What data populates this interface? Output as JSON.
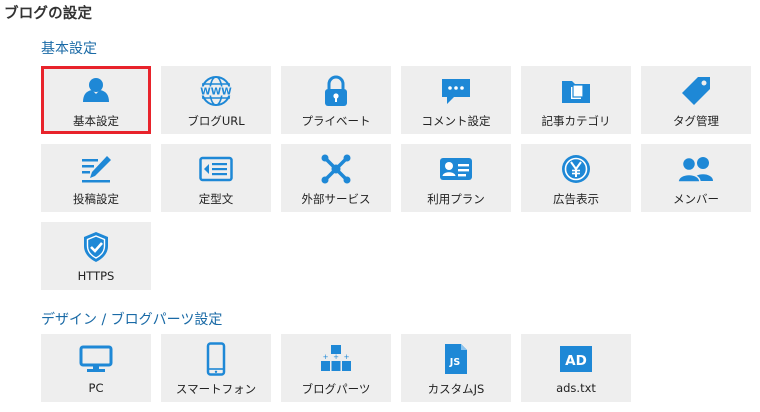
{
  "page": {
    "title": "ブログの設定"
  },
  "colors": {
    "icon": "#1e88d6",
    "selected_border": "#e8232b",
    "tile_bg": "#eeeeee",
    "section_title": "#1a6aa6"
  },
  "sections": [
    {
      "title": "基本設定",
      "items": [
        {
          "label": "基本設定",
          "icon": "user-icon",
          "selected": true
        },
        {
          "label": "ブログURL",
          "icon": "www-globe-icon"
        },
        {
          "label": "プライベート",
          "icon": "lock-icon"
        },
        {
          "label": "コメント設定",
          "icon": "comment-icon"
        },
        {
          "label": "記事カテゴリ",
          "icon": "folder-icon"
        },
        {
          "label": "タグ管理",
          "icon": "tag-icon"
        },
        {
          "label": "投稿設定",
          "icon": "pencil-icon"
        },
        {
          "label": "定型文",
          "icon": "template-icon"
        },
        {
          "label": "外部サービス",
          "icon": "external-services-icon"
        },
        {
          "label": "利用プラン",
          "icon": "plan-card-icon"
        },
        {
          "label": "広告表示",
          "icon": "yen-coin-icon"
        },
        {
          "label": "メンバー",
          "icon": "members-icon"
        },
        {
          "label": "HTTPS",
          "icon": "shield-check-icon"
        }
      ]
    },
    {
      "title": "デザイン / ブログパーツ設定",
      "items": [
        {
          "label": "PC",
          "icon": "monitor-icon"
        },
        {
          "label": "スマートフォン",
          "icon": "smartphone-icon"
        },
        {
          "label": "ブログパーツ",
          "icon": "blog-parts-icon"
        },
        {
          "label": "カスタムJS",
          "icon": "js-file-icon"
        },
        {
          "label": "ads.txt",
          "icon": "ad-icon",
          "icon_text": "AD"
        }
      ]
    }
  ]
}
